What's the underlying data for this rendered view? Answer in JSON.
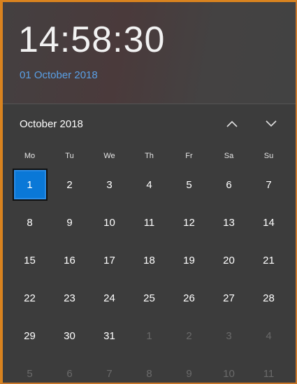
{
  "header": {
    "time": "14:58:30",
    "date": "01 October 2018"
  },
  "month_nav": {
    "label": "October 2018",
    "prev_icon": "chevron-up-icon",
    "next_icon": "chevron-down-icon"
  },
  "days_of_week": [
    "Mo",
    "Tu",
    "We",
    "Th",
    "Fr",
    "Sa",
    "Su"
  ],
  "weeks": [
    [
      "1",
      "2",
      "3",
      "4",
      "5",
      "6",
      "7"
    ],
    [
      "8",
      "9",
      "10",
      "11",
      "12",
      "13",
      "14"
    ],
    [
      "15",
      "16",
      "17",
      "18",
      "19",
      "20",
      "21"
    ],
    [
      "22",
      "23",
      "24",
      "25",
      "26",
      "27",
      "28"
    ],
    [
      "29",
      "30",
      "31",
      "1",
      "2",
      "3",
      "4"
    ],
    [
      "5",
      "6",
      "7",
      "8",
      "9",
      "10",
      "11"
    ]
  ],
  "colors": {
    "accent": "#0a78d7",
    "date_link": "#5aa0e6",
    "window_border": "#d9831f",
    "background": "#3c3c3c"
  }
}
